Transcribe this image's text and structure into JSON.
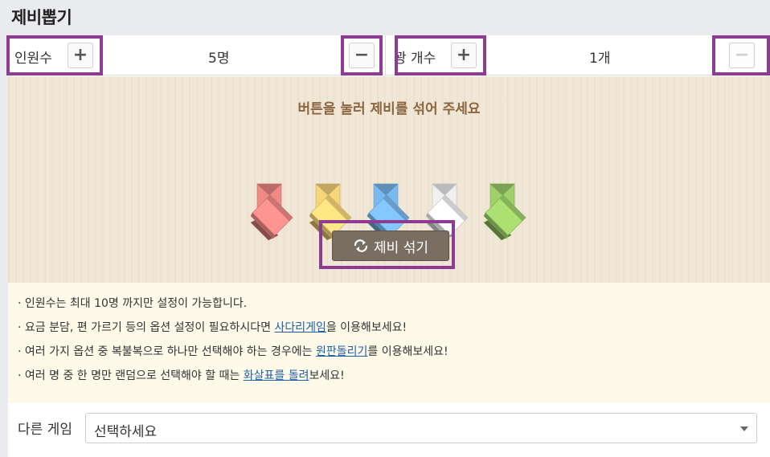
{
  "title": "제비뽑기",
  "people": {
    "label": "인원수",
    "value": "5명"
  },
  "prizes": {
    "label": "꽝 개수",
    "value": "1개"
  },
  "buttons": {
    "plus": "+",
    "minus": "−"
  },
  "instruction": "버튼을 눌러 제비를 섞어 주세요",
  "lots": [
    {
      "color": "#f08a86"
    },
    {
      "color": "#f7d67a"
    },
    {
      "color": "#7ab9ef"
    },
    {
      "color": "#f0f0f0"
    },
    {
      "color": "#9fd06a"
    }
  ],
  "shuffle_label": "제비 섞기",
  "notes": {
    "n1": "· 인원수는 최대 10명 까지만 설정이 가능합니다.",
    "n2_pre": "· 요금 분담, 편 가르기 등의 옵션 설정이 필요하시다면 ",
    "n2_link": "사다리게임",
    "n2_post": "을 이용해보세요!",
    "n3_pre": "· 여러 가지 옵션 중 복불복으로 하나만 선택해야 하는 경우에는 ",
    "n3_link": "원판돌리기",
    "n3_post": "를 이용해보세요!",
    "n4_pre": "· 여러 명 중 한 명만 랜덤으로 선택해야 할 때는 ",
    "n4_link": "화살표를 돌려",
    "n4_post": "보세요!"
  },
  "other_game": {
    "label": "다른 게임",
    "selected": "선택하세요"
  },
  "colors": {
    "highlight": "#8e3c93",
    "shuffle_button": "#7a6d61",
    "link": "#1f5fa8"
  }
}
